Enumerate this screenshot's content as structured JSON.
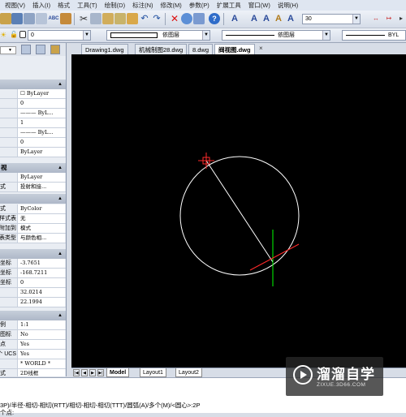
{
  "menubar": {
    "items": [
      "视图(V)",
      "插入(I)",
      "格式",
      "工具(T)",
      "绘制(D)",
      "标注(N)",
      "修改(M)",
      "参数(P)",
      "扩展工具",
      "窗口(W)",
      "说明(H)"
    ]
  },
  "toolbar": {
    "text_height": "30",
    "layer_value": "0",
    "color_combo": "依图层",
    "linetype_combo": "依图层",
    "lineweight_combo": "BYL"
  },
  "doc_tabs": [
    "Drawing1.dwg",
    "机械制图28.dwg",
    "8.dwg",
    "阀视图.dwg"
  ],
  "active_doc_close": "×",
  "properties": {
    "general": [
      {
        "label": "",
        "value": "☐ ByLayer"
      },
      {
        "label": "",
        "value": "0"
      },
      {
        "label": "",
        "value": "——— ByL..."
      },
      {
        "label": "",
        "value": "1"
      },
      {
        "label": "",
        "value": "——— ByL..."
      },
      {
        "label": "",
        "value": "0"
      },
      {
        "label": "",
        "value": "ByLayer"
      }
    ],
    "section2_title": "视",
    "section2": [
      {
        "label": "",
        "value": "ByLayer"
      },
      {
        "label": "式",
        "value": "投射和接..."
      }
    ],
    "section3": [
      {
        "label": "式",
        "value": "ByColor"
      },
      {
        "label": "样式表",
        "value": "无"
      },
      {
        "label": "附加到",
        "value": "模式"
      },
      {
        "label": "表类型",
        "value": "与颜色相..."
      }
    ],
    "section4": [
      {
        "label": "坐标",
        "value": "-3.7651"
      },
      {
        "label": "坐标",
        "value": "-168.7211"
      },
      {
        "label": "坐标",
        "value": "0"
      },
      {
        "label": "",
        "value": "32.0214"
      },
      {
        "label": "",
        "value": "22.1994"
      }
    ],
    "section5": [
      {
        "label": "例",
        "value": "1:1"
      },
      {
        "label": "图标",
        "value": "No"
      },
      {
        "label": "点",
        "value": "Yes"
      },
      {
        "label": "个 UCS",
        "value": "Yes"
      },
      {
        "label": "",
        "value": "* WORLD *"
      },
      {
        "label": "式",
        "value": "2D线框"
      }
    ]
  },
  "layout_tabs": [
    "Model",
    "Layout1",
    "Layout2"
  ],
  "command": {
    "line1": "3P)/半径-相切-相切(RTT)/相切-相切-相切(TTT)/圆弧(A)/多个(M)/<圆心>:2P",
    "line2": "个点:"
  },
  "watermark": {
    "title": "溜溜自学",
    "subtitle": "ZIXUE.3D66.COM"
  },
  "colors": {
    "viewport": "#000000",
    "circle": "#ffffff",
    "marker": "#ff2a2a",
    "tangent_green": "#00ff00",
    "ui_panel": "#e9edf3"
  }
}
